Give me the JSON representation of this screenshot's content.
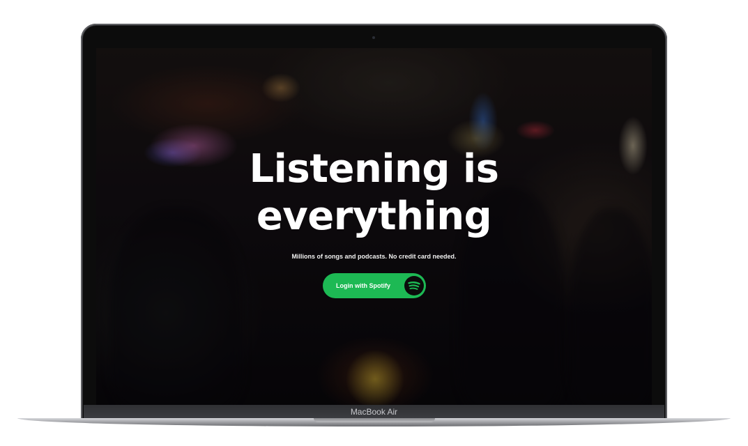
{
  "hero": {
    "headline_line1": "Listening is",
    "headline_line2": "everything",
    "subline": "Millions of songs and podcasts. No credit card needed."
  },
  "login_button": {
    "label": "Login with Spotify",
    "icon": "spotify-logo-icon",
    "color": "#1db954"
  },
  "device": {
    "brand_label": "MacBook Air"
  }
}
